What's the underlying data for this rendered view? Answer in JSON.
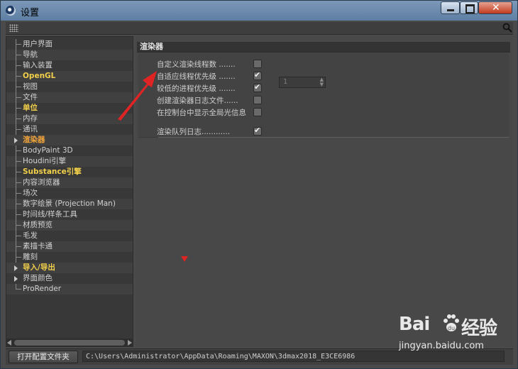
{
  "window": {
    "title": "设置"
  },
  "sidebar": {
    "items": [
      {
        "label": "用户界面",
        "style": "normal",
        "expandable": false
      },
      {
        "label": "导航",
        "style": "normal",
        "expandable": false
      },
      {
        "label": "输入装置",
        "style": "normal",
        "expandable": false
      },
      {
        "label": "OpenGL",
        "style": "highlight",
        "expandable": false
      },
      {
        "label": "视图",
        "style": "normal",
        "expandable": false
      },
      {
        "label": "文件",
        "style": "normal",
        "expandable": false
      },
      {
        "label": "单位",
        "style": "highlight",
        "expandable": false
      },
      {
        "label": "内存",
        "style": "normal",
        "expandable": false
      },
      {
        "label": "通讯",
        "style": "normal",
        "expandable": false
      },
      {
        "label": "渲染器",
        "style": "selected",
        "expandable": true
      },
      {
        "label": "BodyPaint 3D",
        "style": "normal",
        "expandable": false
      },
      {
        "label": "Houdini引擎",
        "style": "normal",
        "expandable": false
      },
      {
        "label": "Substance引擎",
        "style": "highlight",
        "expandable": false
      },
      {
        "label": "内容浏览器",
        "style": "normal",
        "expandable": false
      },
      {
        "label": "场次",
        "style": "normal",
        "expandable": false
      },
      {
        "label": "数字绘景 (Projection Man)",
        "style": "normal",
        "expandable": false
      },
      {
        "label": "时间线/样条工具",
        "style": "normal",
        "expandable": false
      },
      {
        "label": "材质预览",
        "style": "normal",
        "expandable": false
      },
      {
        "label": "毛发",
        "style": "normal",
        "expandable": false
      },
      {
        "label": "素描卡通",
        "style": "normal",
        "expandable": false
      },
      {
        "label": "雕刻",
        "style": "normal",
        "expandable": false
      },
      {
        "label": "导入/导出",
        "style": "highlight",
        "expandable": true
      },
      {
        "label": "界面颜色",
        "style": "normal",
        "expandable": true
      },
      {
        "label": "ProRender",
        "style": "normal",
        "expandable": false
      }
    ]
  },
  "panel": {
    "section_title": "渲染器",
    "settings": [
      {
        "label": "自定义渲染线程数 .......",
        "checked": false
      },
      {
        "label": "自适应线程优先级 .......",
        "checked": true
      },
      {
        "label": "较低的进程优先级 .......",
        "checked": true
      },
      {
        "label": "创建渲染器日志文件......",
        "checked": false
      },
      {
        "label": "在控制台中显示全局光信息",
        "checked": false
      }
    ],
    "thread_count": "1",
    "render_queue": {
      "label": "渲染队列日志............",
      "checked": true
    }
  },
  "footer": {
    "open_button": "打开配置文件夹",
    "path": "C:\\Users\\Administrator\\AppData\\Roaming\\MAXON\\3dmax2018_E3CE6986"
  },
  "watermark": {
    "main": "Bai",
    "main2": "经验",
    "sub": "jingyan.baidu.com"
  },
  "colors": {
    "highlight": "#f2d04a",
    "selected": "#f3a53a",
    "annotation": "#e02424"
  }
}
